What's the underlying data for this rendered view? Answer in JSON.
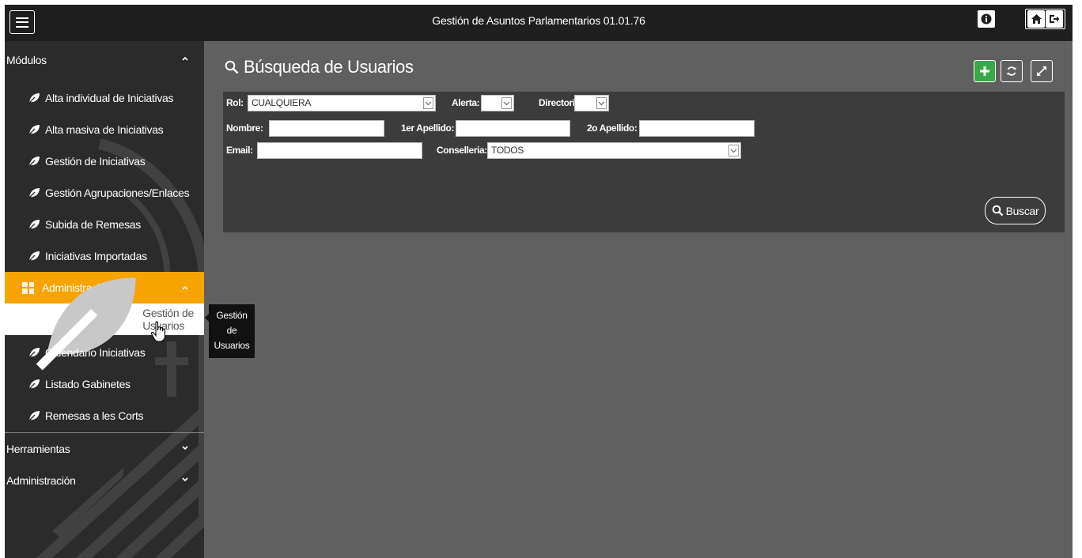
{
  "topbar": {
    "title": "Gestión de Asuntos Parlamentarios 01.01.76",
    "icons": [
      "menu-icon",
      "info-icon",
      "home-icon",
      "logout-icon"
    ]
  },
  "sidebar": {
    "sections": [
      {
        "label": "Módulos",
        "expanded": true,
        "items": [
          {
            "label": "Alta individual de Iniciativas",
            "icon": "leaf-icon"
          },
          {
            "label": "Alta masiva de Iniciativas",
            "icon": "leaf-icon"
          },
          {
            "label": "Gestión de Iniciativas",
            "icon": "leaf-icon"
          },
          {
            "label": "Gestión Agrupaciones/Enlaces",
            "icon": "leaf-icon"
          },
          {
            "label": "Subida de Remesas",
            "icon": "leaf-icon"
          },
          {
            "label": "Iniciativas Importadas",
            "icon": "leaf-icon"
          }
        ],
        "active_group": {
          "label": "Administración",
          "icon": "grid-icon",
          "active_item": "Gestión de Usuarios"
        },
        "more_items": [
          {
            "label": "Calendario Iniciativas",
            "icon": "leaf-icon"
          },
          {
            "label": "Listado Gabinetes",
            "icon": "leaf-icon"
          },
          {
            "label": "Remesas a les Corts",
            "icon": "leaf-icon"
          }
        ]
      },
      {
        "label": "Herramientas",
        "expanded": false
      },
      {
        "label": "Administración",
        "expanded": false
      }
    ],
    "active_color": "#f7a400"
  },
  "tooltip": {
    "lines": [
      "Gestión",
      "de",
      "Usuarios"
    ]
  },
  "main": {
    "title": "Búsqueda de Usuarios",
    "actions": [
      "add-icon",
      "refresh-icon",
      "expand-icon"
    ],
    "accent_green": "#3aa84a"
  },
  "search": {
    "rol": {
      "label": "Rol:",
      "value": "CUALQUIERA"
    },
    "alerta": {
      "label": "Alerta:",
      "value": ""
    },
    "directorio": {
      "label": "Directorio:",
      "value": ""
    },
    "nombre": {
      "label": "Nombre:",
      "value": ""
    },
    "apellido1": {
      "label": "1er Apellido:",
      "value": ""
    },
    "apellido2": {
      "label": "2o Apellido:",
      "value": ""
    },
    "email": {
      "label": "Email:",
      "value": ""
    },
    "conselleria": {
      "label": "Conselleria:",
      "value": "TODOS"
    },
    "button_label": "Buscar"
  }
}
